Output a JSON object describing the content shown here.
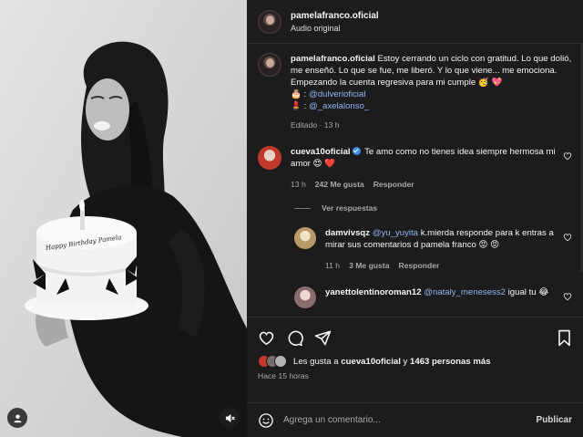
{
  "post": {
    "username": "pamelafranco.oficial",
    "audio": "Audio original"
  },
  "caption": {
    "username": "pamelafranco.oficial",
    "text": "Estoy cerrando un ciclo con gratitud. Lo que dolió, me enseñó. Lo que se fue, me liberó. Y lo que viene... me emociona.",
    "countdown": "Empezando la cuenta regresiva para mi cumple 🥳 💖",
    "credit1_emoji": "🎂 :",
    "credit1_handle": "@dulverioficial",
    "credit2_emoji": "💄 :",
    "credit2_handle": "@_axelalonso_",
    "edited": "Editado · 13 h"
  },
  "comments": [
    {
      "username": "cueva10oficial",
      "text": "Te amo como no tienes idea siempre hermosa mi amor 😍 ❤️",
      "time": "13 h",
      "likes": "242 Me gusta",
      "reply_label": "Responder"
    }
  ],
  "view_replies": "Ver respuestas",
  "replies": [
    {
      "username": "damvivsqz",
      "mention": "@yu_yuyita",
      "text": "k.mierda responde para k entras a mirar sus comentarios d pamela franco 😡 😡",
      "time": "11 h",
      "likes": "3 Me gusta",
      "reply_label": "Responder"
    },
    {
      "username": "yanettolentinoroman12",
      "mention": "@nataly_menesess2",
      "text": "igual tu 😂"
    }
  ],
  "likes_summary": {
    "prefix": "Les gusta a ",
    "user": "cueva10oficial",
    "middle": " y ",
    "count": "1463 personas más"
  },
  "posted_ago": "Hace 15 horas",
  "add_comment": {
    "placeholder": "Agrega un comentario...",
    "publish": "Publicar"
  },
  "photo_overlay": {
    "cake_text": "Happy Birthday Pamela"
  },
  "colors": {
    "panel_bg": "#1c1c1c",
    "link": "#8fb4f0",
    "verified": "#3d8ef0",
    "heart_red": "#e0245e"
  },
  "icons": [
    "user-tag-icon",
    "mute-icon",
    "heart-icon",
    "comment-icon",
    "share-icon",
    "bookmark-icon",
    "emoji-icon",
    "verified-icon"
  ]
}
